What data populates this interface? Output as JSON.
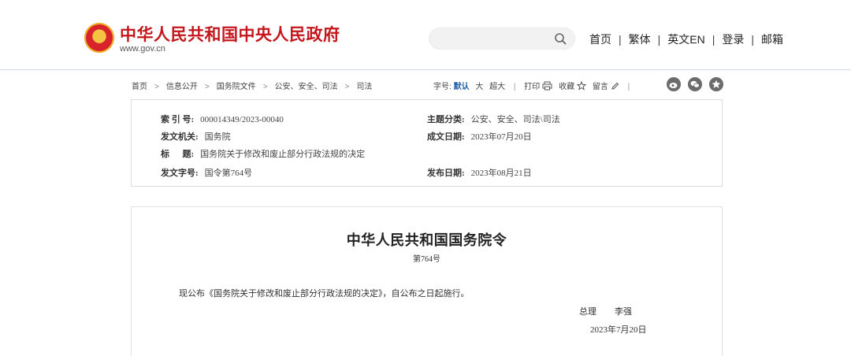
{
  "header": {
    "site_title": "中华人民共和国中央人民政府",
    "site_url": "www.gov.cn",
    "search_placeholder": "",
    "nav": [
      {
        "label": "首页"
      },
      {
        "label": "繁体"
      },
      {
        "label": "英文EN"
      },
      {
        "label": "登录"
      },
      {
        "label": "邮箱"
      }
    ],
    "nav_separator": "|"
  },
  "breadcrumb": {
    "items": [
      "首页",
      "信息公开",
      "国务院文件",
      "公安、安全、司法",
      "司法"
    ],
    "arrow": ">"
  },
  "tools": {
    "font_label": "字号:",
    "font_default": "默认",
    "font_large": "大",
    "font_xlarge": "超大",
    "print": "打印",
    "favorite": "收藏",
    "comment": "留言",
    "separator": "|"
  },
  "info": {
    "index_key": "索 引 号:",
    "index_val": "000014349/2023-00040",
    "category_key": "主题分类:",
    "category_val": "公安、安全、司法\\司法",
    "issuer_key": "发文机关:",
    "issuer_val": "国务院",
    "date_written_key": "成文日期:",
    "date_written_val": "2023年07月20日",
    "title_key": "标      题:",
    "title_val": "国务院关于修改和废止部分行政法规的决定",
    "doc_no_key": "发文字号:",
    "doc_no_val": "国令第764号",
    "publish_key": "发布日期:",
    "publish_val": "2023年08月21日"
  },
  "document": {
    "title": "中华人民共和国国务院令",
    "number": "第764号",
    "body": "现公布《国务院关于修改和废止部分行政法规的决定》，自公布之日起施行。",
    "signer_role": "总理",
    "signer_name": "李强",
    "date": "2023年7月20日"
  },
  "colors": {
    "brand_red": "#c4161c",
    "link_blue": "#1f5fa8",
    "emblem_gold": "#f6c343"
  }
}
